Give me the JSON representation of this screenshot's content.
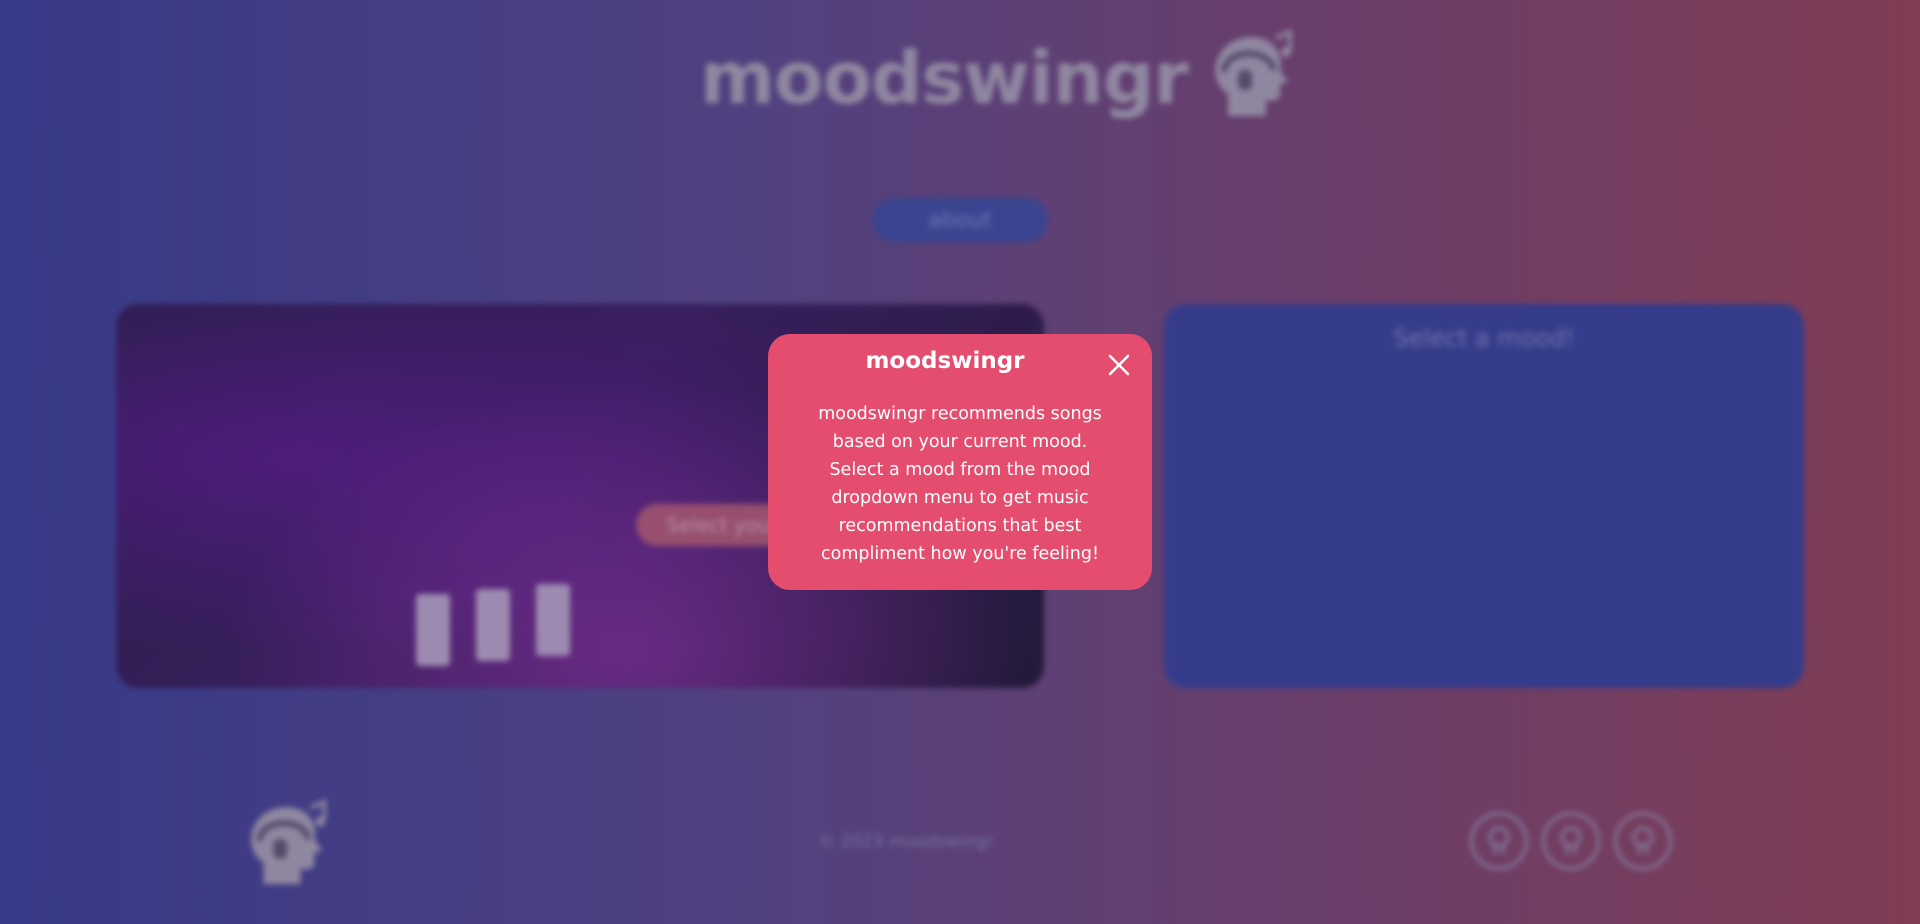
{
  "header": {
    "title": "moodswingr",
    "logo_icon": "head-headphones-icon"
  },
  "nav": {
    "about_label": "about"
  },
  "left_panel": {
    "select_label": "Select your"
  },
  "right_panel": {
    "title": "Select a mood!"
  },
  "footer": {
    "copyright": "© 2023 moodswingr",
    "logo_icon": "head-headphones-icon",
    "social_links": [
      {
        "icon": "github-icon"
      },
      {
        "icon": "github-icon"
      },
      {
        "icon": "github-icon"
      }
    ]
  },
  "modal": {
    "title": "moodswingr",
    "close_icon": "close-icon",
    "body": "moodswingr recommends songs based on your current mood. Select a mood from the mood dropdown menu to get music recommendations that best compliment how you're feeling!"
  },
  "colors": {
    "modal_bg": "#e44d6e",
    "panel_bg": "#394499",
    "about_bg": "#3f4ea0"
  }
}
